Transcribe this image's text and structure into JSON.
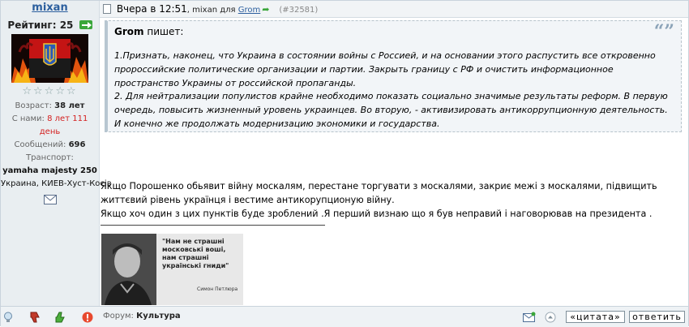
{
  "author": {
    "username": "mixan",
    "rating_label": "Рейтинг:",
    "rating_value": "25",
    "stars": "☆☆☆☆☆",
    "age_label": "Возраст:",
    "age_value": "38 лет",
    "joined_label": "С нами:",
    "joined_value": "8 лет 111 день",
    "messages_label": "Сообщений:",
    "messages_value": "696",
    "transport_label": "Транспорт:",
    "transport_value": "yamaha majesty 250",
    "location": "Украина, КИЕВ-Хуст-Косів"
  },
  "post": {
    "time": "Вчера в 12:51",
    "author": "mixan",
    "for_word": "для",
    "recipient": "Grom",
    "post_number": "(#32581)"
  },
  "quote": {
    "author": "Grom",
    "says": "пишет:",
    "text": "1.Признать, наконец, что Украина в состоянии войны с Россией, и на основании этого распустить все откровенно пророссийские политические организации и партии. Закрыть границу с РФ и очистить информационное пространство Украины от российской пропаганды.\n2. Для нейтрализации популистов крайне необходимо показать социально значимые результаты реформ. В первую очередь, повысить жизненный уровень украинцев. Во вторую, - активизировать антикоррупционную деятельность.\nИ конечно же продолжать модернизацию экономики и государства."
  },
  "body": {
    "line1": "Якщо Порошенко обьявит війну москалям, перестане торгувати з москалями, закриє межі з москалями, підвищить життєвий рівень українця і вестиме антикорупционую війну.",
    "line2": "Якщо хоч один з цих пунктів буде зроблений .Я перший визнаю що я був неправий і наговорював на президента ."
  },
  "signature": {
    "quote_text": "\"Нам не страшні московські воші, нам страшні українські гниди\"",
    "name": "Симон Петлюра"
  },
  "footer": {
    "forum_label": "Форум:",
    "forum_value": "Культура",
    "quote_button": "«цитата»",
    "reply_button": "ответить"
  },
  "colors": {
    "link": "#2c5f9e",
    "sidebar_bg": "#e9eef1",
    "accent_red": "#d42020",
    "plus_green": "#3aa63a"
  },
  "icons": [
    "plus-icon",
    "document-icon",
    "arrow-icon",
    "quote-mark-icon",
    "envelope-icon",
    "bulb-icon",
    "thumbs-down-icon",
    "thumbs-up-icon",
    "report-icon",
    "pm-icon",
    "up-icon"
  ]
}
